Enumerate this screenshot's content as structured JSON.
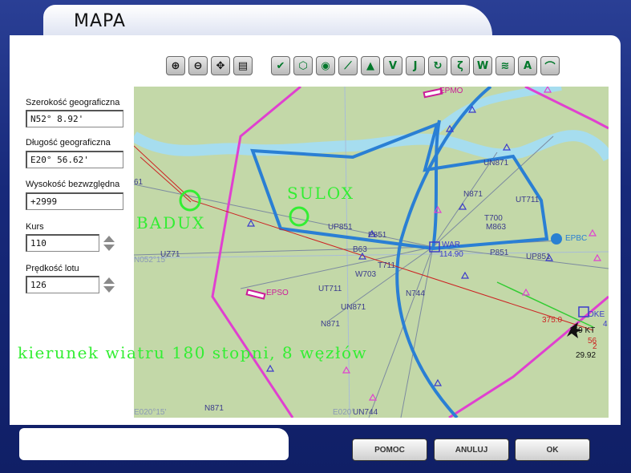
{
  "window": {
    "title": "MAPA"
  },
  "toolbar": {
    "map_tools": [
      {
        "name": "zoom-in-icon",
        "glyph": "⊕"
      },
      {
        "name": "zoom-out-icon",
        "glyph": "⊖"
      },
      {
        "name": "center-aircraft-icon",
        "glyph": "✥"
      },
      {
        "name": "print-icon",
        "glyph": "▤"
      }
    ],
    "layer_tools": [
      {
        "name": "check-icon",
        "glyph": "✔"
      },
      {
        "name": "ndb-icon",
        "glyph": "⬡"
      },
      {
        "name": "vor-signal-icon",
        "glyph": "◉"
      },
      {
        "name": "runway-icon",
        "glyph": "⟋"
      },
      {
        "name": "triangle-waypoint-icon",
        "glyph": "▲"
      },
      {
        "name": "victor-airway-icon",
        "glyph": "V"
      },
      {
        "name": "jet-airway-icon",
        "glyph": "J"
      },
      {
        "name": "refresh-icon",
        "glyph": "↻"
      },
      {
        "name": "route-icon",
        "glyph": "ζ"
      },
      {
        "name": "weather-icon",
        "glyph": "W"
      },
      {
        "name": "wind-icon",
        "glyph": "≋"
      },
      {
        "name": "airspace-icon",
        "glyph": "A"
      },
      {
        "name": "terrain-icon",
        "glyph": "⌒"
      }
    ]
  },
  "fields": {
    "latitude": {
      "label": "Szerokość geograficzna",
      "value": "N52° 8.92'"
    },
    "longitude": {
      "label": "Długość geograficzna",
      "value": "E20° 56.62'"
    },
    "altitude": {
      "label": "Wysokość bezwzględna",
      "value": "+2999"
    },
    "heading": {
      "label": "Kurs",
      "value": "110"
    },
    "speed": {
      "label": "Prędkość lotu",
      "value": "126"
    }
  },
  "map": {
    "overlay_text": "kierunek wiatru 180 stopni, 8 węzłów",
    "waypoints_big": [
      "BADUX",
      "SULOX"
    ],
    "labels": {
      "epmo": "EPMO",
      "epso": "EPSO",
      "epbc": "EPBC",
      "war": "WAR",
      "war_freq": "114.90",
      "un871a": "UN871",
      "n871a": "N871",
      "ut711a": "UT711",
      "up851a": "UP851",
      "p851a": "P851",
      "p851b": "P851",
      "b63": "B63",
      "t711": "T711",
      "w703": "W703",
      "n744": "N744",
      "ut711b": "UT711",
      "un871b": "UN871",
      "n871b": "N871",
      "up851b": "UP851",
      "t700": "T700",
      "m863": "M863",
      "uz71": "UZ71",
      "n052": "N052°15'",
      "e020a": "E020°15'",
      "e020b": "E020°",
      "un744": "UN744",
      "n871c": "N871",
      "f61": "61",
      "alt375": "375.0",
      "ok": "OKE",
      "baro": "29.92",
      "v169": "169 KT",
      "v4": "4",
      "v56": "56",
      "v2": "2"
    }
  },
  "buttons": {
    "help": "POMOC",
    "cancel": "ANULUJ",
    "ok": "OK"
  },
  "colors": {
    "airspace": "#e040d0",
    "tma": "#2a7fd4",
    "route": "#cc2222",
    "wind_text": "#33ee33",
    "map_bg": "#c3d8a8",
    "river": "#a6ddef"
  }
}
